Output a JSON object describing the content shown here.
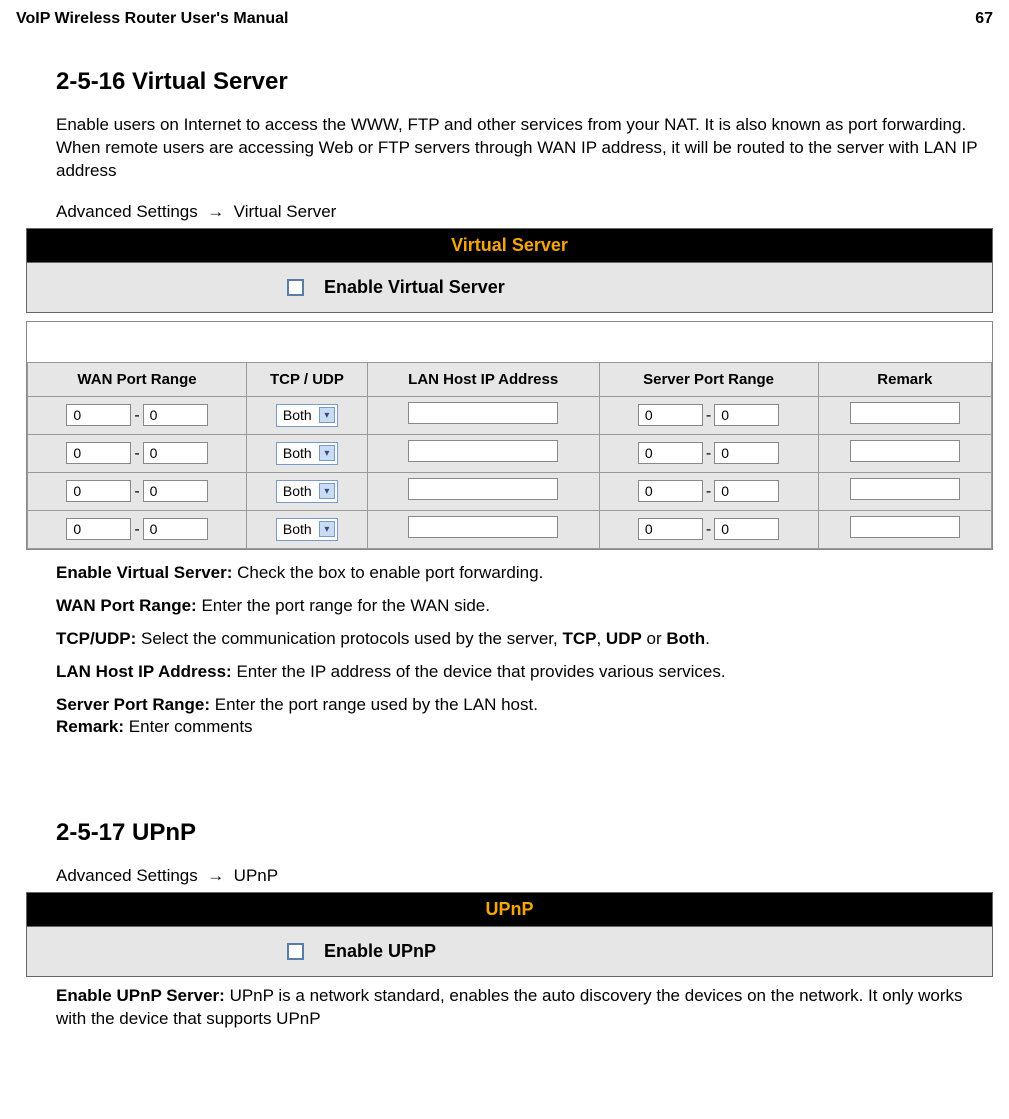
{
  "header": {
    "title": "VoIP Wireless Router User's Manual",
    "page": "67"
  },
  "sec1": {
    "heading": "2-5-16 Virtual Server",
    "intro": "Enable users on Internet to access the WWW, FTP and other services from your NAT. It is also known as port forwarding. When remote users are accessing Web or FTP servers through WAN IP address, it will be routed to the server with LAN IP address",
    "breadcrumb_a": "Advanced Settings",
    "breadcrumb_arrow": "→",
    "breadcrumb_b": "Virtual Server",
    "panel_title": "Virtual Server",
    "enable_label": "Enable Virtual Server",
    "cols": {
      "wan": "WAN Port Range",
      "proto": "TCP / UDP",
      "lan": "LAN Host IP Address",
      "srv": "Server Port Range",
      "remark": "Remark"
    },
    "row_val": "0",
    "row_sel": "Both",
    "defs": {
      "enable_b": "Enable Virtual Server:",
      "enable_t": "Check the box to enable port forwarding.",
      "wan_b": "WAN Port Range:",
      "wan_t": "Enter the port range for the WAN side.",
      "proto_b": "TCP/UDP:",
      "proto_t1": "Select the communication protocols used by the server, ",
      "proto_tcp": "TCP",
      "proto_comma": ", ",
      "proto_udp": "UDP",
      "proto_or": " or ",
      "proto_both": "Both",
      "proto_dot": ".",
      "lan_b": "LAN Host IP Address:",
      "lan_t": "Enter the IP address of the device that provides various services.",
      "srv_b": "Server Port Range:",
      "srv_t": "Enter the port range used by the LAN host.",
      "rem_b": "Remark:",
      "rem_t": "Enter comments"
    }
  },
  "sec2": {
    "heading": "2-5-17 UPnP",
    "breadcrumb_a": "Advanced Settings",
    "breadcrumb_arrow": "→",
    "breadcrumb_b": "UPnP",
    "panel_title": "UPnP",
    "enable_label": "Enable UPnP",
    "defs": {
      "enable_b": "Enable UPnP Server:",
      "enable_t": "UPnP is a network standard, enables the auto discovery the devices on the network. It only works with the device that supports UPnP"
    }
  }
}
